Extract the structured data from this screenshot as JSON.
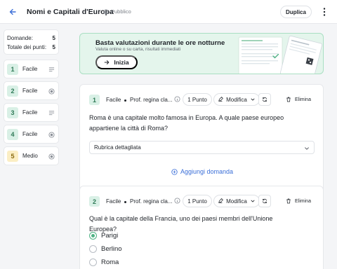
{
  "header": {
    "title": "Nomi e Capitali d'Europa",
    "visibility": "Pubblico",
    "duplicate_label": "Duplica",
    "icons": [
      "back-arrow-icon",
      "globe-icon",
      "more-vertical-icon"
    ]
  },
  "sidebar": {
    "stats": [
      {
        "label": "Domande:",
        "value": "5"
      },
      {
        "label": "Totale dei punti:",
        "value": "5"
      }
    ],
    "questions": [
      {
        "number": "1",
        "difficulty": "Facile",
        "type_icon": "text-lines-icon"
      },
      {
        "number": "2",
        "difficulty": "Facile",
        "type_icon": "radio-icon"
      },
      {
        "number": "3",
        "difficulty": "Facile",
        "type_icon": "text-lines-icon"
      },
      {
        "number": "4",
        "difficulty": "Facile",
        "type_icon": "radio-icon"
      },
      {
        "number": "5",
        "difficulty": "Medio",
        "type_icon": "radio-icon"
      }
    ]
  },
  "banner": {
    "title": "Basta valutazioni durante le ore notturne",
    "subtitle": "Valuta online o su carta, risultati immediati",
    "start_label": "Inizia"
  },
  "questions": [
    {
      "number": "1",
      "difficulty": "Facile",
      "author": "Prof. regina cla...",
      "points": "1 Punto",
      "edit_label": "Modifica",
      "delete_label": "Elimina",
      "text": "Roma è una capitale molto famosa in Europa. A quale paese europeo appartiene la città di Roma?",
      "rubric": "Rubrica dettagliata"
    },
    {
      "number": "2",
      "difficulty": "Facile",
      "author": "Prof. regina cla...",
      "points": "1 Punto",
      "edit_label": "Modifica",
      "delete_label": "Elimina",
      "text": "Qual è la capitale della Francia, uno dei paesi membri dell'Unione Europea?",
      "options": [
        {
          "label": "Parigi",
          "selected": true
        },
        {
          "label": "Berlino",
          "selected": false
        },
        {
          "label": "Roma",
          "selected": false
        }
      ]
    }
  ],
  "add_question_label": "Aggiungi domanda",
  "colors": {
    "accent_blue": "#3b6fd8",
    "easy_badge": "#d9f0e6",
    "medium_badge": "#fbeec4",
    "banner_bg": "#e4f5ec",
    "selected_radio": "#4fb384"
  }
}
